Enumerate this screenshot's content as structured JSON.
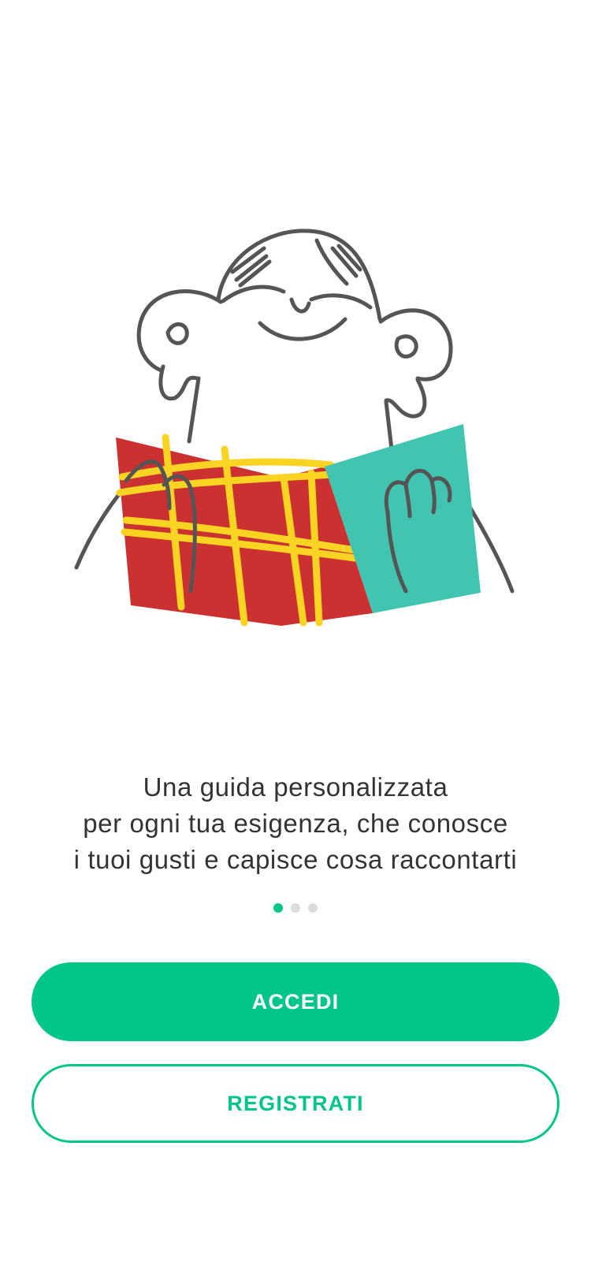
{
  "onboarding": {
    "illustration_icon": "reading-person-illustration",
    "tagline_lines": [
      "Una guida personalizzata",
      "per ogni tua esigenza, che conosce",
      "i tuoi gusti e capisce cosa raccontarti"
    ],
    "pagination": {
      "current_page": 1,
      "total_pages": 3
    }
  },
  "actions": {
    "login_label": "ACCEDI",
    "register_label": "REGISTRATI"
  },
  "colors": {
    "accent": "#02c58a",
    "text": "#333333",
    "dot_inactive": "#dcdcdc",
    "book_red": "#cc3131",
    "book_yellow": "#f9d422",
    "book_teal": "#41c4b0",
    "sketch_line": "#555555"
  }
}
